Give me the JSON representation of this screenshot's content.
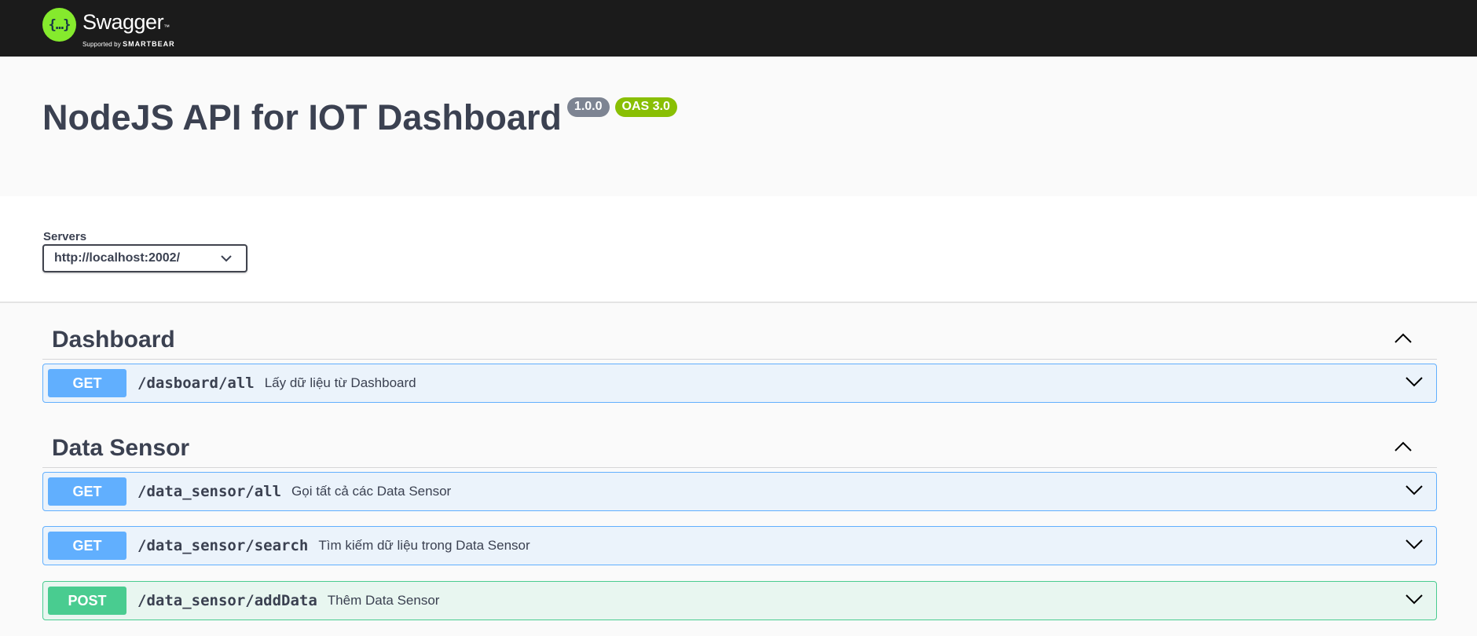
{
  "topbar": {
    "logo_glyph": "{…}",
    "logo_name": "Swagger",
    "logo_tm": "™",
    "logo_sub_prefix": "Supported by",
    "logo_sub_brand": "SMARTBEAR"
  },
  "info": {
    "title": "NodeJS API for IOT Dashboard",
    "version": "1.0.0",
    "oas": "OAS 3.0"
  },
  "servers": {
    "label": "Servers",
    "selected": "http://localhost:2002/"
  },
  "tags": [
    {
      "name": "Dashboard",
      "operations": [
        {
          "method": "GET",
          "path": "/dasboard/all",
          "summary": "Lấy dữ liệu từ Dashboard"
        }
      ]
    },
    {
      "name": "Data Sensor",
      "operations": [
        {
          "method": "GET",
          "path": "/data_sensor/all",
          "summary": "Gọi tất cả các Data Sensor"
        },
        {
          "method": "GET",
          "path": "/data_sensor/search",
          "summary": "Tìm kiếm dữ liệu trong Data Sensor"
        },
        {
          "method": "POST",
          "path": "/data_sensor/addData",
          "summary": "Thêm Data Sensor"
        }
      ]
    }
  ],
  "colors": {
    "topbar": "#1b1b1b",
    "logo_green": "#85ea2d",
    "get": "#61affe",
    "post": "#49cc90",
    "oas_badge": "#89bf04",
    "version_badge": "#7d8492"
  }
}
